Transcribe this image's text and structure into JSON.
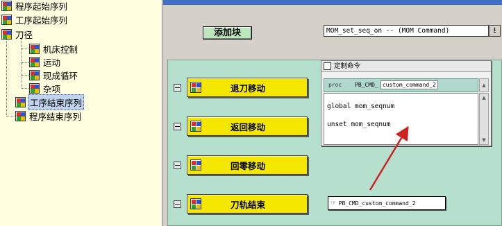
{
  "tree": {
    "items": [
      {
        "label": "程序起始序列",
        "level": 0
      },
      {
        "label": "工序起始序列",
        "level": 0
      },
      {
        "label": "刀径",
        "level": 0
      },
      {
        "label": "机床控制",
        "level": 1
      },
      {
        "label": "运动",
        "level": 1
      },
      {
        "label": "现成循环",
        "level": 1
      },
      {
        "label": "杂项",
        "level": 1
      },
      {
        "label": "工序结束序列",
        "level": 0,
        "selected": true
      },
      {
        "label": "程序结束序列",
        "level": 0
      }
    ]
  },
  "toolbar": {
    "add_block_label": "添加块",
    "command_select_value": "MOM_set_seq_on -- (MOM Command)",
    "dropdown_icon": "download-arrow-icon"
  },
  "blocks": [
    {
      "label": "退刀移动"
    },
    {
      "label": "返回移动"
    },
    {
      "label": "回零移动"
    },
    {
      "label": "刀轨结束"
    }
  ],
  "popup": {
    "title": "定制命令",
    "proc_keyword": "proc",
    "proc_prefix": "PB_CMD_",
    "proc_name": "custom_command_2",
    "lines": [
      "global mom_seqnum",
      "unset mom_seqnum"
    ]
  },
  "command_tag": {
    "label": "PB_CMD_custom_command_2",
    "icon": "pointing-hand-icon"
  },
  "colors": {
    "tree_bg": "#ffffe0",
    "canvas_bg": "#b5e0cd",
    "block_fill": "#f4e800",
    "add_button": "#bce6bc",
    "arrow": "#cc2222",
    "topbar": "#3f6fc8"
  }
}
